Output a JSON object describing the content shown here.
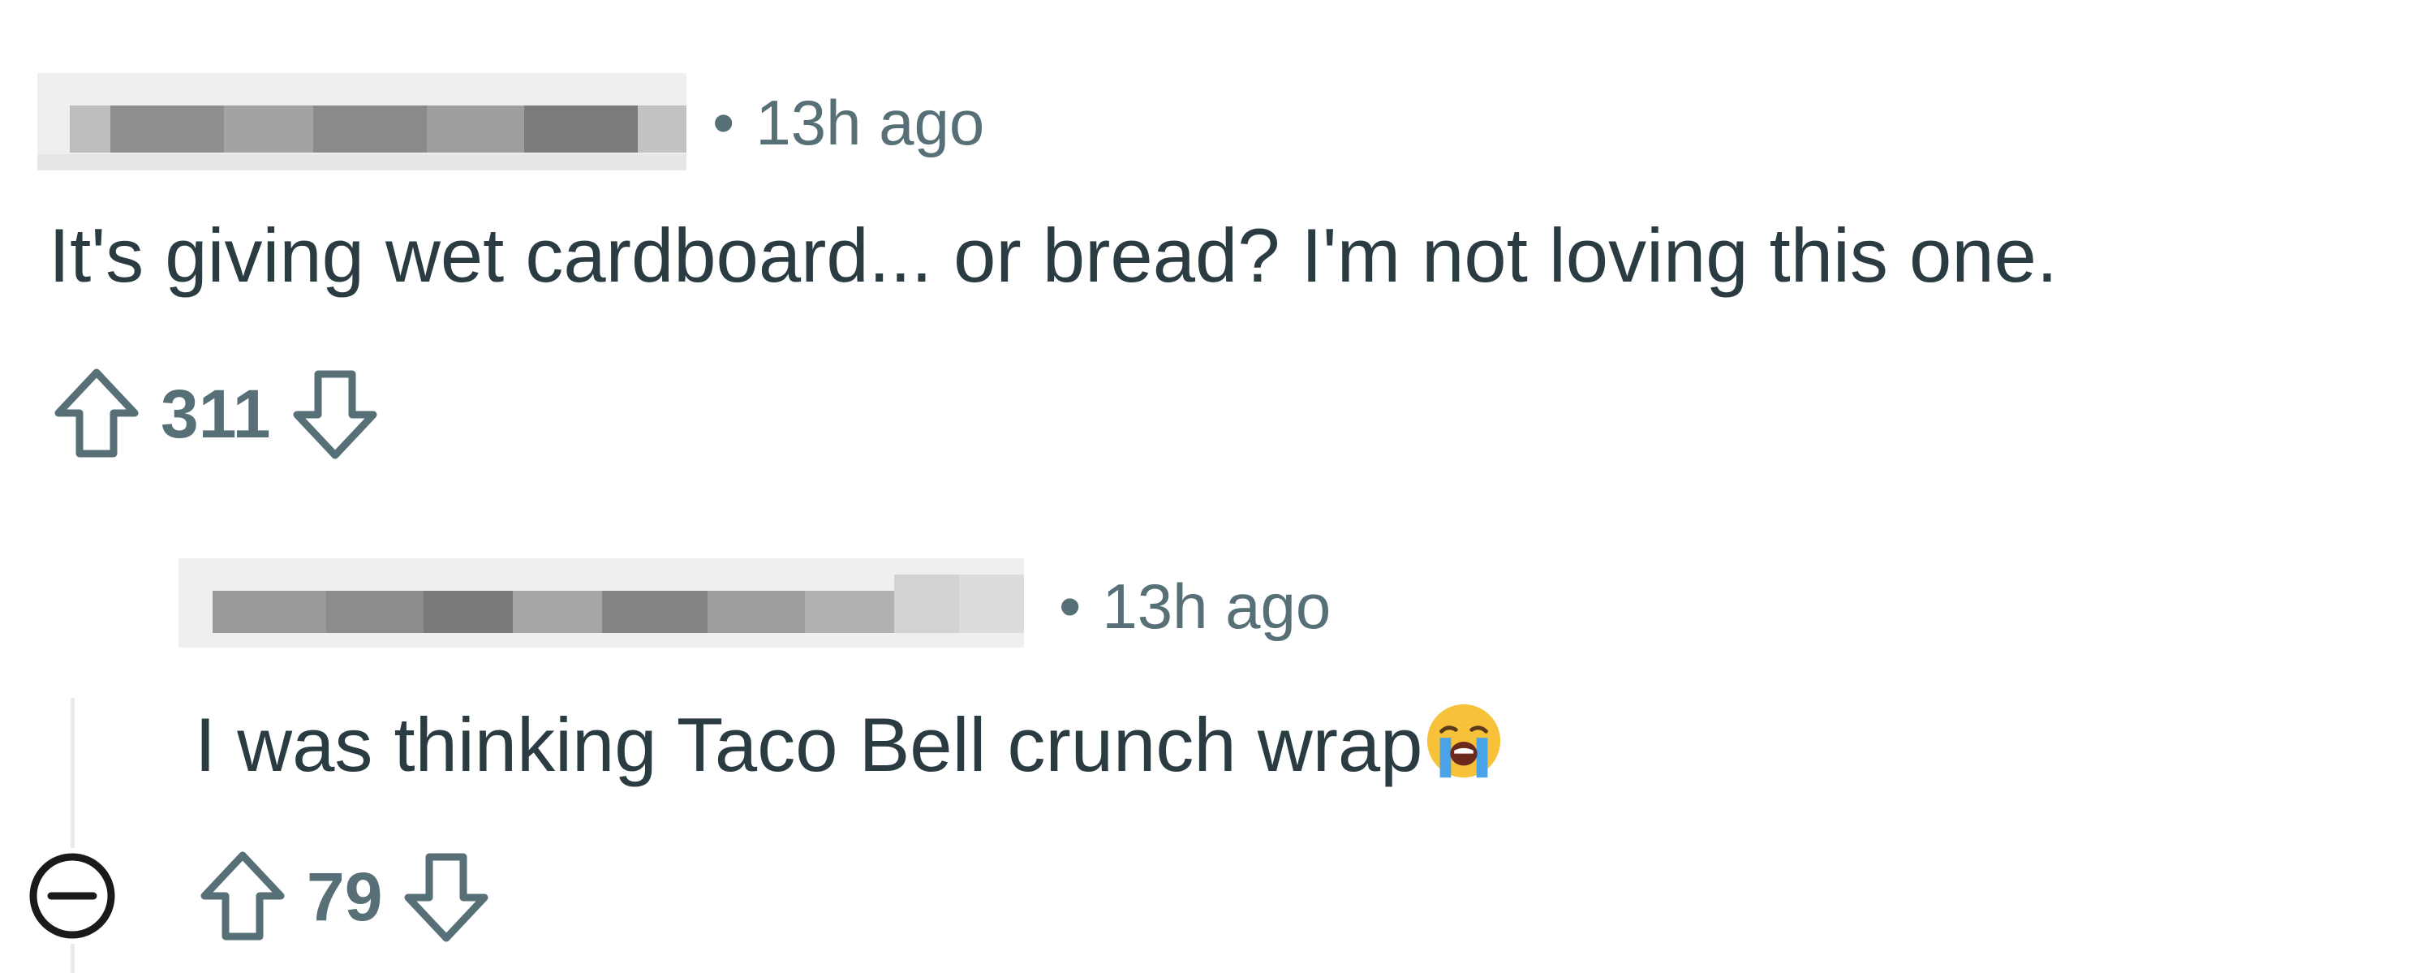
{
  "comments": [
    {
      "author_display": "",
      "separator": "•",
      "timestamp": "13h ago",
      "body": "It's giving wet cardboard... or bread? I'm not loving this one.",
      "score": "311"
    },
    {
      "author_display": "",
      "separator": "•",
      "timestamp": "13h ago",
      "body": "I was thinking Taco Bell crunch wrap",
      "emoji": "loudly-crying-face",
      "score": "79"
    }
  ],
  "icons": {
    "upvote": "upvote-arrow-icon",
    "downvote": "downvote-arrow-icon",
    "collapse": "collapse-thread-icon"
  },
  "colors": {
    "text": "#2a3c42",
    "meta": "#576f76",
    "thread_line": "#e5ebee",
    "icon_stroke": "#576f76",
    "collapse_icon": "#1a1a1b"
  }
}
